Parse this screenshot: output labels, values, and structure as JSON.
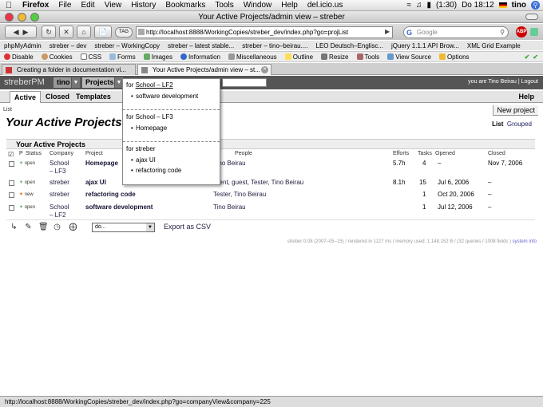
{
  "menubar": {
    "app": "Firefox",
    "items": [
      "File",
      "Edit",
      "View",
      "History",
      "Bookmarks",
      "Tools",
      "Window",
      "Help",
      "del.icio.us"
    ],
    "battery": "(1:30)",
    "clock": "Do 18:12",
    "user": "tino"
  },
  "window": {
    "title": "Your Active Projects/admin view – streber"
  },
  "navbar": {
    "url": "http://localhost:8888/WorkingCopies/streber_dev/index.php?go=projList",
    "search_placeholder": "Google",
    "tag_label": "TAG"
  },
  "bookmarks": [
    "phpMyAdmin",
    "streber – dev",
    "streber – WorkingCopy",
    "streber – latest stable...",
    "streber – tino–beirau....",
    "LEO Deutsch–Englisc...",
    "jQuery 1.1.1 API Brow...",
    "XML Grid Example"
  ],
  "devbar": [
    "Disable",
    "Cookies",
    "CSS",
    "Forms",
    "Images",
    "Information",
    "Miscellaneous",
    "Outline",
    "Resize",
    "Tools",
    "View Source",
    "Options"
  ],
  "tabs": [
    {
      "label": "Creating a folder in documentation vi...",
      "active": false
    },
    {
      "label": "Your Active Projects/admin view – st...",
      "active": true
    }
  ],
  "header": {
    "logo": "streberPM",
    "nav_user": "tino",
    "nav_projects": "Projects",
    "userinfo": "you are Tino Beirau | Logout"
  },
  "subtabs": {
    "active": "Active",
    "closed": "Closed",
    "templates": "Templates",
    "help": "Help"
  },
  "crumb": "List",
  "new_project": "New project",
  "page_title": "Your Active Projects:",
  "viewswitch": {
    "list": "List",
    "grouped": "Grouped"
  },
  "table": {
    "title": "Your Active Projects",
    "columns": {
      "p": "P",
      "status": "Status",
      "company": "Company",
      "project": "Project",
      "people": "People",
      "efforts": "Efforts",
      "tasks": "Tasks",
      "opened": "Opened",
      "closed": "Closed"
    },
    "rows": [
      {
        "status": "open",
        "company_1": "School",
        "company_2": "– LF3",
        "project": "Homepage",
        "people": "Tino Beirau",
        "efforts": "5.7h",
        "tasks": "4",
        "opened": "–",
        "closed": "Nov 7, 2006"
      },
      {
        "status": "open",
        "company_1": "streber",
        "company_2": "",
        "project": "ajax UI",
        "people": "client, guest, Tester, Tino Beirau",
        "efforts": "8.1h",
        "tasks": "15",
        "opened": "Jul 6, 2006",
        "closed": "–"
      },
      {
        "status": "new",
        "company_1": "streber",
        "company_2": "",
        "project": "refactoring code",
        "people": "Tester, Tino Beirau",
        "efforts": "",
        "tasks": "1",
        "opened": "Oct 20, 2006",
        "closed": "–"
      },
      {
        "status": "open",
        "company_1": "School",
        "company_2": "– LF2",
        "project": "software development",
        "people": "Tino Beirau",
        "efforts": "",
        "tasks": "1",
        "opened": "Jul 12, 2006",
        "closed": "–"
      }
    ],
    "do_select": "do...",
    "export": "Export as CSV"
  },
  "footer": {
    "text": "streber 0.08 (2007–05–15)  /  rendered in 1127 ms / memory used: 1.148.152 B  /  (32 queries / 1008 fields )",
    "sysinfo": "system info"
  },
  "dropdown": {
    "sections": [
      {
        "for": "for",
        "company": "School – LF2",
        "items": [
          "software development"
        ]
      },
      {
        "for": "for",
        "company": "School – LF3",
        "items": [
          "Homepage"
        ]
      },
      {
        "for": "for",
        "company": "streber",
        "items": [
          "ajax UI",
          "refactoring code"
        ]
      }
    ]
  },
  "statusbar": "http://localhost:8888/WorkingCopies/streber_dev/index.php?go=companyView&company=225"
}
